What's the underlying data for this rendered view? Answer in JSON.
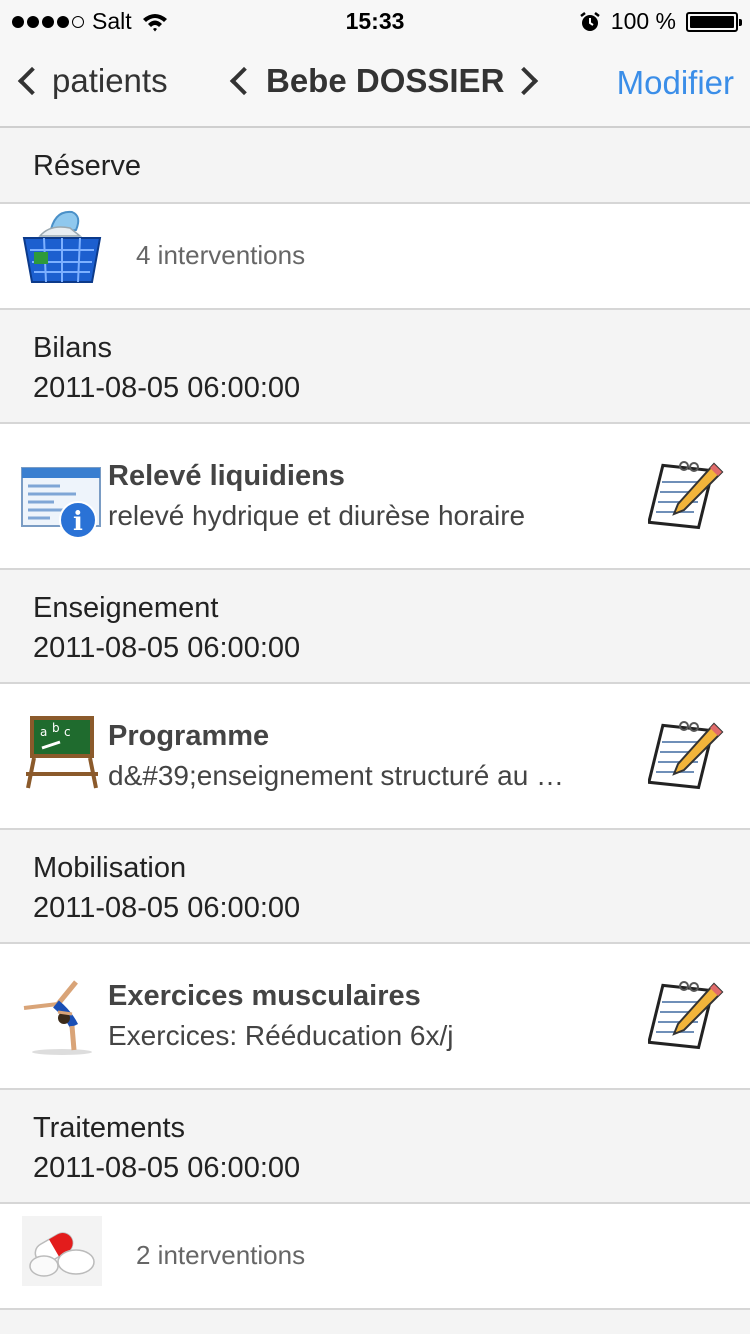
{
  "status_bar": {
    "carrier": "Salt",
    "time": "15:33",
    "battery": "100 %",
    "icons": [
      "signal-dots-icon",
      "wifi-icon",
      "alarm-icon",
      "battery-icon"
    ]
  },
  "nav": {
    "back_label": "patients",
    "title": "Bebe DOSSIER",
    "edit_label": "Modifier",
    "accent_color": "#3b8ee8"
  },
  "sections": [
    {
      "title": "Réserve",
      "date": "",
      "row": {
        "type": "count",
        "icon": "basket-icon",
        "count": "4 interventions"
      }
    },
    {
      "title": "Bilans",
      "date": "2011-08-05 06:00:00",
      "row": {
        "type": "detail",
        "icon": "info-form-icon",
        "title": "Relevé liquidiens",
        "subtitle": "relevé hydrique et diurèse horaire",
        "action_icon": "notepad-pencil-icon"
      }
    },
    {
      "title": "Enseignement",
      "date": "2011-08-05 06:00:00",
      "row": {
        "type": "detail",
        "icon": "chalkboard-icon",
        "title": "Programme",
        "subtitle": "d&#39;enseignement structuré au …",
        "action_icon": "notepad-pencil-icon"
      }
    },
    {
      "title": "Mobilisation",
      "date": "2011-08-05 06:00:00",
      "row": {
        "type": "detail",
        "icon": "gymnast-icon",
        "title": "Exercices musculaires",
        "subtitle": "Exercices: Rééducation 6x/j",
        "action_icon": "notepad-pencil-icon"
      }
    },
    {
      "title": "Traitements",
      "date": "2011-08-05 06:00:00",
      "row": {
        "type": "count",
        "icon": "pills-icon",
        "count": "2 interventions"
      }
    }
  ]
}
